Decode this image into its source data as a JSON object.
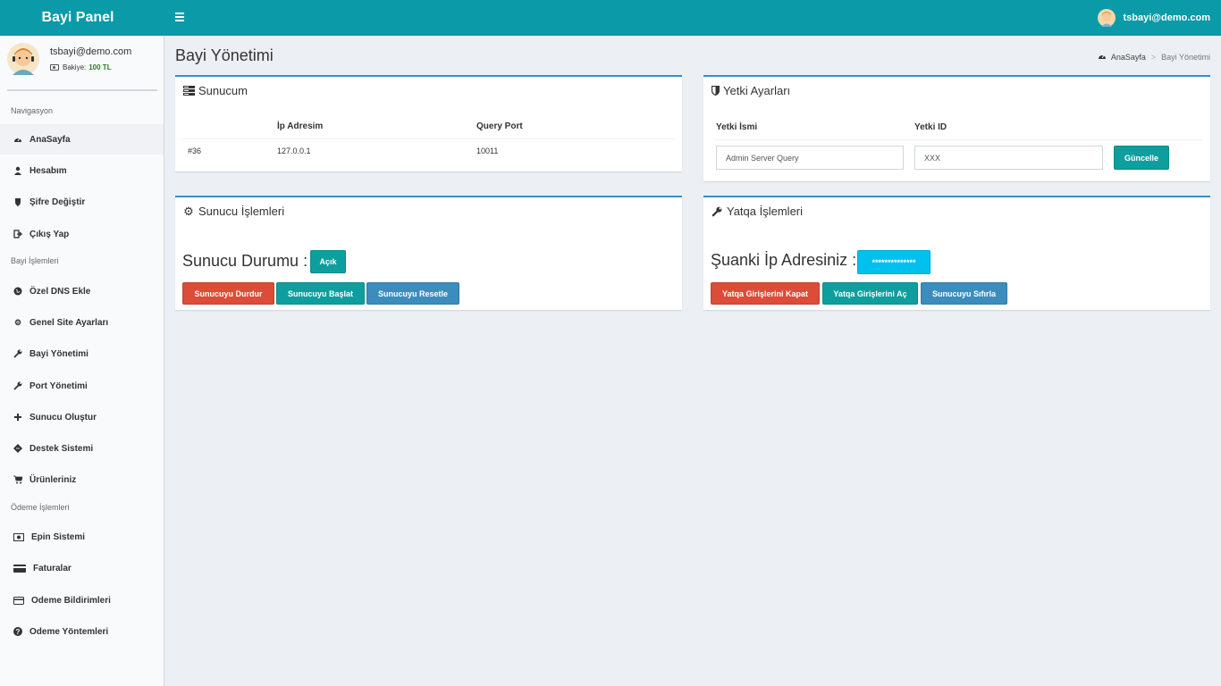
{
  "header": {
    "brand": "Bayi Panel",
    "user_email": "tsbayi@demo.com"
  },
  "sidebar": {
    "user_email": "tsbayi@demo.com",
    "balance_label": "Bakiye:",
    "balance_value": "100 TL",
    "section_nav": "Navigasyon",
    "section_bayi": "Bayi İşlemleri",
    "section_odeme": "Ödeme İşlemleri",
    "items": [
      {
        "label": "AnaSayfa",
        "icon": "dashboard-icon"
      },
      {
        "label": "Hesabım",
        "icon": "user-icon"
      },
      {
        "label": "Şifre Değiştir",
        "icon": "shield-icon"
      },
      {
        "label": "Çıkış Yap",
        "icon": "sign-out-icon"
      },
      {
        "label": "Özel DNS Ekle",
        "icon": "globe-icon"
      },
      {
        "label": "Genel Site Ayarları",
        "icon": "gear-icon"
      },
      {
        "label": "Bayi Yönetimi",
        "icon": "wrench-icon"
      },
      {
        "label": "Port Yönetimi",
        "icon": "wrench-icon"
      },
      {
        "label": "Sunucu Oluştur",
        "icon": "plus-icon"
      },
      {
        "label": "Destek Sistemi",
        "icon": "ticket-icon"
      },
      {
        "label": "Ürünleriniz",
        "icon": "cart-icon"
      },
      {
        "label": "Epin Sistemi",
        "icon": "money-icon"
      },
      {
        "label": "Faturalar",
        "icon": "credit-card-icon"
      },
      {
        "label": "Odeme Bildirimleri",
        "icon": "credit-card-icon"
      },
      {
        "label": "Odeme Yöntemleri",
        "icon": "question-icon"
      }
    ]
  },
  "page": {
    "title": "Bayi Yönetimi",
    "breadcrumb_home": "AnaSayfa",
    "breadcrumb_current": "Bayi Yönetimi"
  },
  "sunucum": {
    "title": "Sunucum",
    "columns": [
      "",
      "İp Adresim",
      "Query Port"
    ],
    "rows": [
      [
        "#36",
        "127.0.0.1",
        "10011"
      ]
    ]
  },
  "yetki": {
    "title": "Yetki Ayarları",
    "name_label": "Yetki İsmi",
    "id_label": "Yetki ID",
    "name_value": "Admin Server Query",
    "id_value": "XXX",
    "update_button": "Güncelle"
  },
  "sunucu_islemleri": {
    "title": "Sunucu İşlemleri",
    "status_label": "Sunucu Durumu :",
    "status_value": "Açık",
    "stop_button": "Sunucuyu Durdur",
    "start_button": "Sunucuyu Başlat",
    "reset_button": "Sunucuyu Resetle"
  },
  "yatqa": {
    "title": "Yatqa İşlemleri",
    "ip_label": "Şuanki İp Adresiniz :",
    "ip_value": "**************",
    "close_button": "Yatqa Girişlerini Kapat",
    "open_button": "Yatqa Girişlerini Aç",
    "reset_button": "Sunucuyu Sıfırla"
  },
  "colors": {
    "header": "#0a9aa8",
    "box_border": "#3c8dbc",
    "teal_button": "#0f9e9e",
    "red_button": "#dd4b39",
    "blue_button": "#3c8dbc",
    "cyan_button": "#00c0ef"
  }
}
